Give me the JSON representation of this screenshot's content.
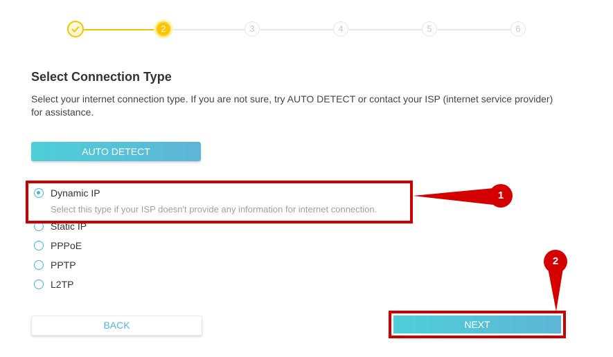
{
  "stepper": {
    "steps": [
      {
        "label": "",
        "state": "done"
      },
      {
        "label": "2",
        "state": "active"
      },
      {
        "label": "3",
        "state": "pending"
      },
      {
        "label": "4",
        "state": "pending"
      },
      {
        "label": "5",
        "state": "pending"
      },
      {
        "label": "6",
        "state": "pending"
      }
    ]
  },
  "page": {
    "title": "Select Connection Type",
    "description": "Select your internet connection type. If you are not sure, try AUTO DETECT or contact your ISP (internet service provider) for assistance."
  },
  "auto_detect_label": "AUTO DETECT",
  "options": [
    {
      "label": "Dynamic IP",
      "checked": true,
      "hint": "Select this type if your ISP doesn't provide any information for internet connection."
    },
    {
      "label": "Static IP",
      "checked": false
    },
    {
      "label": "PPPoE",
      "checked": false
    },
    {
      "label": "PPTP",
      "checked": false
    },
    {
      "label": "L2TP",
      "checked": false
    }
  ],
  "buttons": {
    "back": "BACK",
    "next": "NEXT"
  },
  "annotations": {
    "badge1": "1",
    "badge2": "2"
  },
  "colors": {
    "accent": "#4fcfd8",
    "step_done": "#f5c400",
    "annotation": "#cc0000"
  }
}
